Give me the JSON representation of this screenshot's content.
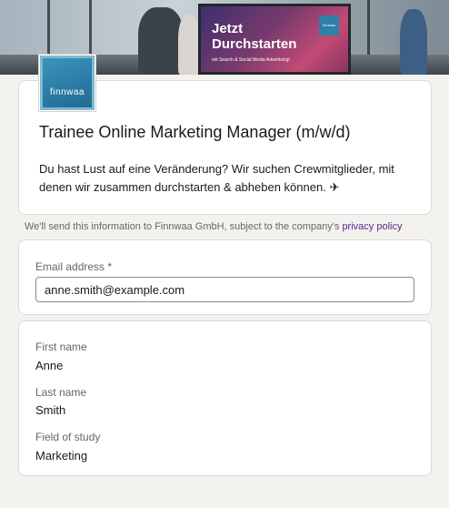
{
  "banner": {
    "billboard_line1": "Jetzt",
    "billboard_line2": "Durchstarten",
    "billboard_sub": "mit Search & Social Media Advertising!",
    "billboard_logo": "finnwaa"
  },
  "company": {
    "logo_text": "finnwaa"
  },
  "job": {
    "title": "Trainee Online Marketing Manager (m/w/d)",
    "description": "Du hast Lust auf eine Veränderung? Wir suchen Crewmitglieder, mit denen wir zusammen durchstarten & abheben können.",
    "description_emoji": "✈"
  },
  "privacy": {
    "text": "We'll send this information to Finnwaa GmbH, subject to the company's ",
    "link": "privacy policy"
  },
  "form": {
    "email_label": "Email address *",
    "email_value": "anne.smith@example.com",
    "first_name_label": "First name",
    "first_name_value": "Anne",
    "last_name_label": "Last name",
    "last_name_value": "Smith",
    "field_of_study_label": "Field of study",
    "field_of_study_value": "Marketing"
  },
  "colors": {
    "link": "#5b2a8c",
    "logo_blue": "#2a7aa3",
    "page_background": "#f3f2ef"
  }
}
